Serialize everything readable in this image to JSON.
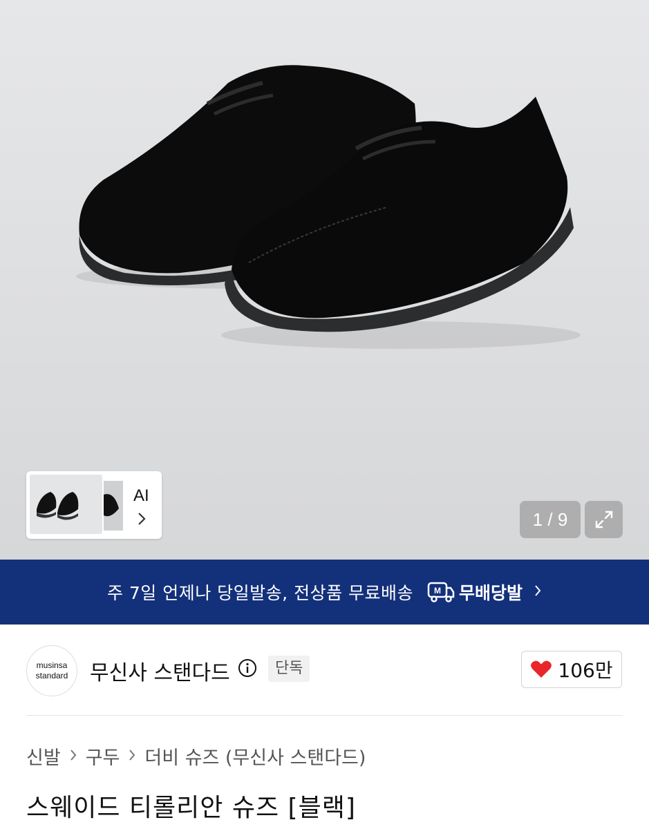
{
  "gallery": {
    "ai_label": "AI",
    "counter": "1 / 9"
  },
  "banner": {
    "text": "주 7일 언제나 당일발송, 전상품 무료배송",
    "logo_text": "무배당발",
    "logo_mark": "M"
  },
  "brand": {
    "logo_line1": "musinsa",
    "logo_line2": "standard",
    "name": "무신사 스탠다드",
    "badge": "단독",
    "likes": "106만"
  },
  "breadcrumb": [
    "신발",
    "구두",
    "더비 슈즈 (무신사 스탠다드)"
  ],
  "product": {
    "title": "스웨이드 티롤리안 슈즈 [블랙]"
  },
  "colors": {
    "banner_bg": "#13307a",
    "heart": "#e8262b"
  },
  "icons": [
    "expand-icon",
    "info-icon",
    "heart-icon",
    "chevron-right-icon",
    "truck-icon"
  ]
}
